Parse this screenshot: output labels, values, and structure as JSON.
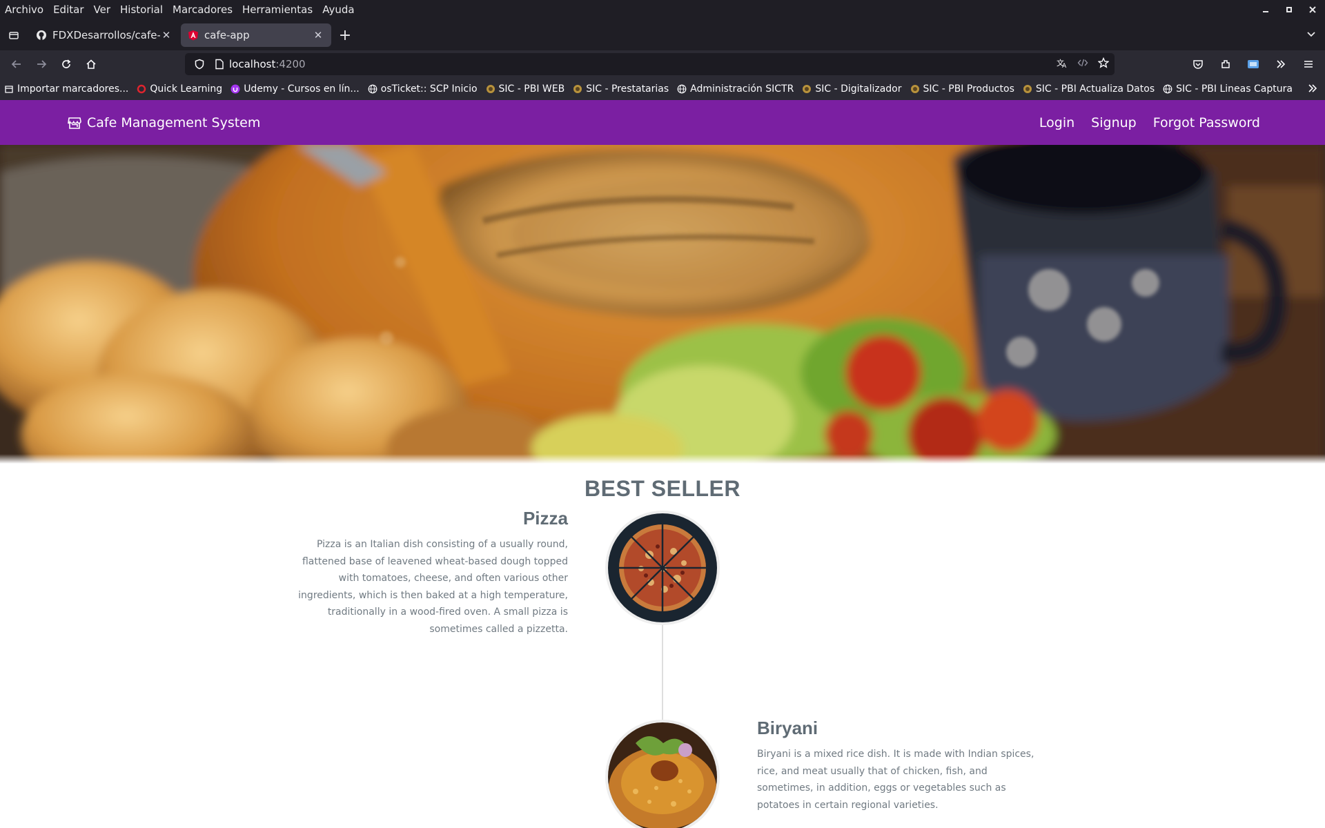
{
  "browser": {
    "menu": [
      "Archivo",
      "Editar",
      "Ver",
      "Historial",
      "Marcadores",
      "Herramientas",
      "Ayuda"
    ],
    "tabs": [
      {
        "title": "FDXDesarrollos/cafe-api",
        "favicon": "github-icon"
      },
      {
        "title": "cafe-app",
        "favicon": "angular-icon"
      }
    ],
    "url": {
      "host": "localhost",
      "port": ":4200"
    },
    "bookmarks": [
      {
        "label": "Importar marcadores...",
        "icon": "import-icon"
      },
      {
        "label": "Quick Learning",
        "icon": "quick-learning-icon"
      },
      {
        "label": "Udemy - Cursos en lín...",
        "icon": "udemy-icon"
      },
      {
        "label": "osTicket:: SCP Inicio",
        "icon": "globe-icon"
      },
      {
        "label": "SIC - PBI WEB",
        "icon": "sic-icon"
      },
      {
        "label": "SIC - Prestatarias",
        "icon": "sic-icon"
      },
      {
        "label": "Administración SICTR",
        "icon": "globe-icon"
      },
      {
        "label": "SIC - Digitalizador",
        "icon": "sic-icon"
      },
      {
        "label": "SIC - PBI Productos",
        "icon": "sic-icon"
      },
      {
        "label": "SIC - PBI Actualiza Datos",
        "icon": "sic-icon"
      },
      {
        "label": "SIC - PBI Lineas Captura",
        "icon": "globe-icon"
      }
    ]
  },
  "app": {
    "brand": "Cafe Management System",
    "nav": {
      "login": "Login",
      "signup": "Signup",
      "forgot": "Forgot Password"
    },
    "colors": {
      "toolbar": "#7b1fa2",
      "heading": "#5f6b74",
      "text": "#707a82"
    },
    "best_seller": {
      "title": "BEST SELLER",
      "items": [
        {
          "name": "Pizza",
          "description": "Pizza is an Italian dish consisting of a usually round, flattened base of leavened wheat-based dough topped with tomatoes, cheese, and often various other ingredients, which is then baked at a high temperature, traditionally in a wood-fired oven. A small pizza is sometimes called a pizzetta."
        },
        {
          "name": "Biryani",
          "description": "Biryani is a mixed rice dish. It is made with Indian spices, rice, and meat usually that of chicken, fish, and sometimes, in addition, eggs or vegetables such as potatoes in certain regional varieties."
        }
      ]
    }
  }
}
